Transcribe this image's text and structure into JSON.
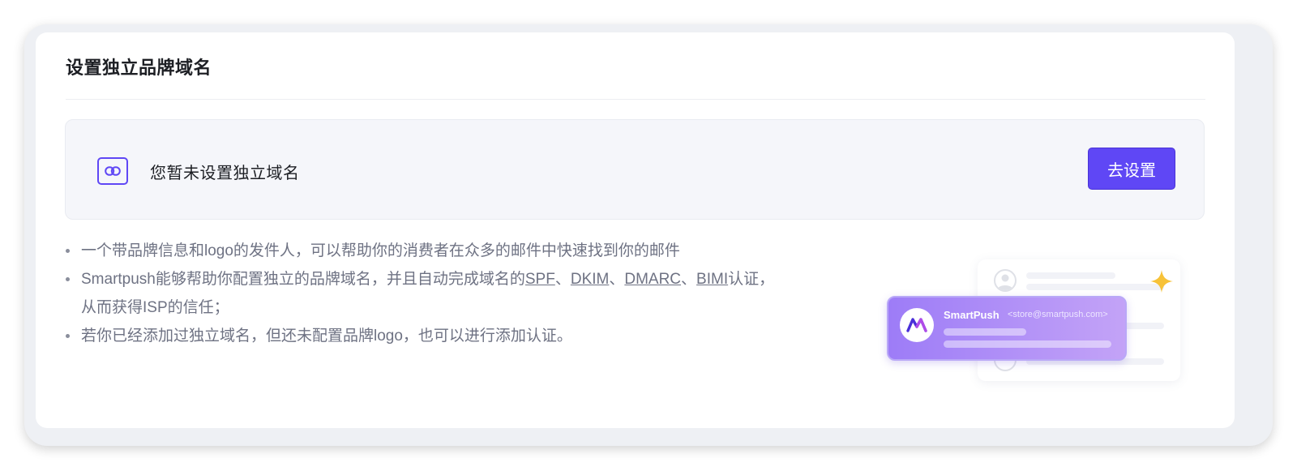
{
  "page": {
    "title": "设置独立品牌域名"
  },
  "banner": {
    "icon": "link-icon",
    "message": "您暂未设置独立域名",
    "button_label": "去设置",
    "accent_color": "#5f47f5"
  },
  "bullets": {
    "item1": "一个带品牌信息和logo的发件人，可以帮助你的消费者在众多的邮件中快速找到你的邮件",
    "item2_prefix": "Smartpush能够帮助你配置独立的品牌域名，并且自动完成域名的",
    "links": [
      "SPF",
      "DKIM",
      "DMARC",
      "BIMI"
    ],
    "separator": "、",
    "item2_suffix": "认证，",
    "item2_line2": "从而获得ISP的信任；",
    "item3": "若你已经添加过独立域名，但还未配置品牌logo，也可以进行添加认证。"
  },
  "illustration": {
    "sender_name": "SmartPush",
    "sender_email": "<store@smartpush.com>",
    "sparkle_icon": "sparkle-icon",
    "brand_icon": "smartpush-logo-icon"
  }
}
